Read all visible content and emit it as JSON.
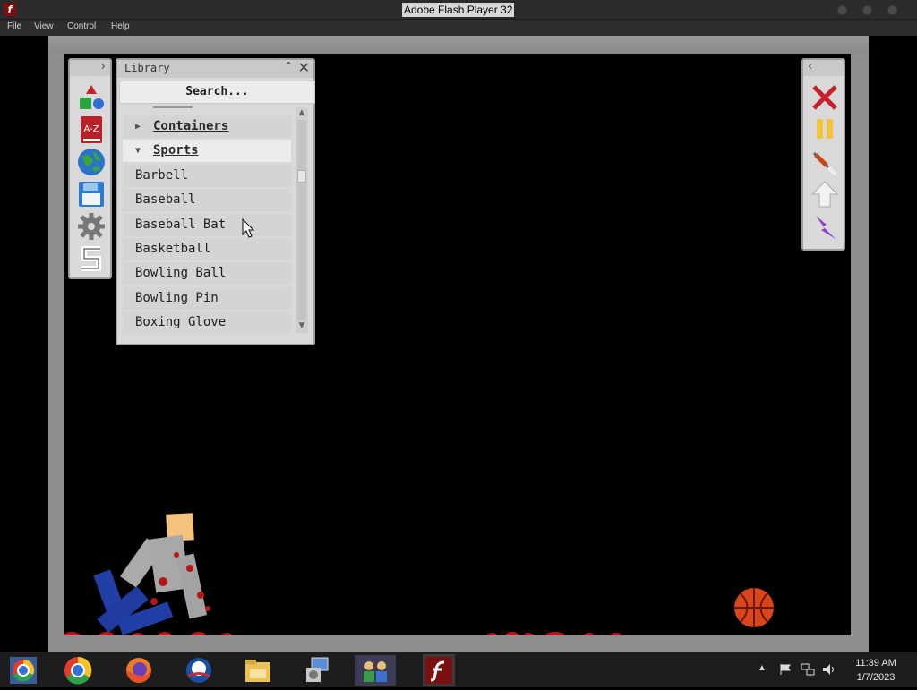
{
  "window": {
    "title": "Adobe Flash Player 32",
    "menu": [
      "File",
      "View",
      "Control",
      "Help"
    ]
  },
  "library": {
    "title": "Library",
    "search_placeholder": "Search...",
    "categories": [
      {
        "label": "Containers",
        "expanded": false
      },
      {
        "label": "Sports",
        "expanded": true
      }
    ],
    "items": [
      "Barbell",
      "Baseball",
      "Baseball Bat",
      "Basketball",
      "Bowling Ball",
      "Bowling Pin",
      "Boxing Glove"
    ]
  },
  "left_tools": [
    "shapes-icon",
    "a-z-book-icon",
    "globe-icon",
    "save-disk-icon",
    "settings-gear-icon",
    "s-logo-icon"
  ],
  "right_tools": [
    "close-x-icon",
    "pause-icon",
    "syringe-icon",
    "up-arrow-icon",
    "lightning-icon"
  ],
  "taskbar": {
    "apps": [
      "chrome-old-icon",
      "chrome-icon",
      "firefox-icon",
      "obama-icon",
      "file-explorer-icon",
      "control-panel-icon",
      "users-icon",
      "flash-player-icon"
    ],
    "time": "11:39 AM",
    "date": "1/7/2023"
  },
  "colors": {
    "stage_bg": "#000000",
    "frame": "#8e8e8e",
    "panel": "#d9d9d9",
    "blood": "#c0181b",
    "accent_red": "#c8202a"
  }
}
